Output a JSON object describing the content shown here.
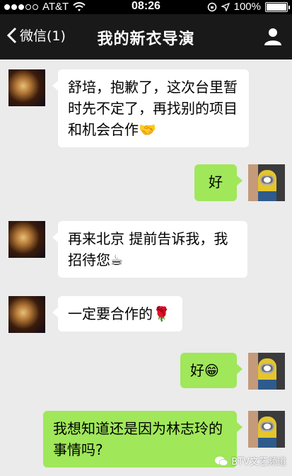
{
  "status_bar": {
    "carrier": "AT&T",
    "time": "08:26",
    "battery": "100%",
    "signal_bars_filled": 3,
    "signal_bars_total": 5,
    "battery_level": 1.0
  },
  "nav": {
    "back_label": "微信(1)",
    "title": "我的新衣导演"
  },
  "messages": [
    {
      "side": "in",
      "text": "舒培，抱歉了，这次台里暂时先不定了，再找别的项目和机会合作🤝"
    },
    {
      "side": "out",
      "text": "好"
    },
    {
      "side": "in",
      "text": "再来北京 提前告诉我，我招待您☕"
    },
    {
      "side": "in",
      "text": "一定要合作的🌹"
    },
    {
      "side": "out",
      "text": "好😁"
    },
    {
      "side": "out",
      "text": "我想知道还是因为林志玲的事情吗?"
    }
  ],
  "watermark": "BTV文艺频道",
  "colors": {
    "nav_bg": "#191919",
    "chat_bg": "#ebebeb",
    "incoming_bubble": "#ffffff",
    "outgoing_bubble": "#a0e75a"
  }
}
